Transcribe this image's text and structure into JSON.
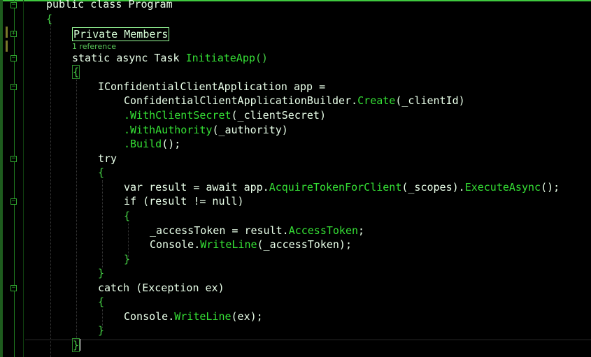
{
  "editor": {
    "lines": {
      "class_decl": "public class Program",
      "open_class": "{",
      "region": "Private Members",
      "codelens": "1 reference",
      "method_sig_kw": "static async ",
      "method_sig_type": "Task ",
      "method_sig_name": "InitiateApp",
      "method_sig_parens": "()",
      "open_method": "{",
      "app_decl_type": "IConfidentialClientApplication ",
      "app_decl_rest": "app =",
      "builder_type": "ConfidentialClientApplicationBuilder",
      "builder_dot": ".",
      "builder_create": "Create",
      "builder_args": "(_clientId)",
      "with_secret_fn": ".WithClientSecret",
      "with_secret_args": "(_clientSecret)",
      "with_authority_fn": ".WithAuthority",
      "with_authority_args": "(_authority)",
      "build_fn": ".Build",
      "build_args": "();",
      "try_kw": "try",
      "try_open": "{",
      "var_kw": "var ",
      "result_assign": "result = await app.",
      "acquire_fn": "AcquireTokenForClient",
      "acquire_args": "(_scopes).",
      "execute_fn": "ExecuteAsync",
      "execute_args": "();",
      "if_kw": "if ",
      "if_cond": "(result != null)",
      "if_open": "{",
      "access_assign": "_accessToken = result.",
      "access_prop": "AccessToken",
      "access_semi": ";",
      "console1_obj": "Console.",
      "console1_fn": "WriteLine",
      "console1_args": "(_accessToken);",
      "if_close": "}",
      "try_close": "}",
      "catch_kw": "catch ",
      "catch_args": "(Exception ex)",
      "catch_open": "{",
      "console2_obj": "Console.",
      "console2_fn": "WriteLine",
      "console2_args": "(ex);",
      "catch_close": "}",
      "method_close": "}"
    },
    "gutter": {
      "collapse_symbol": "−",
      "expand_symbol": "+"
    }
  },
  "colors": {
    "background": "#000000",
    "keyword": "#e9ffe9",
    "type": "#9aff6a",
    "method": "#35e035",
    "brace": "#46d246",
    "border_accent": "#3fc93f"
  }
}
